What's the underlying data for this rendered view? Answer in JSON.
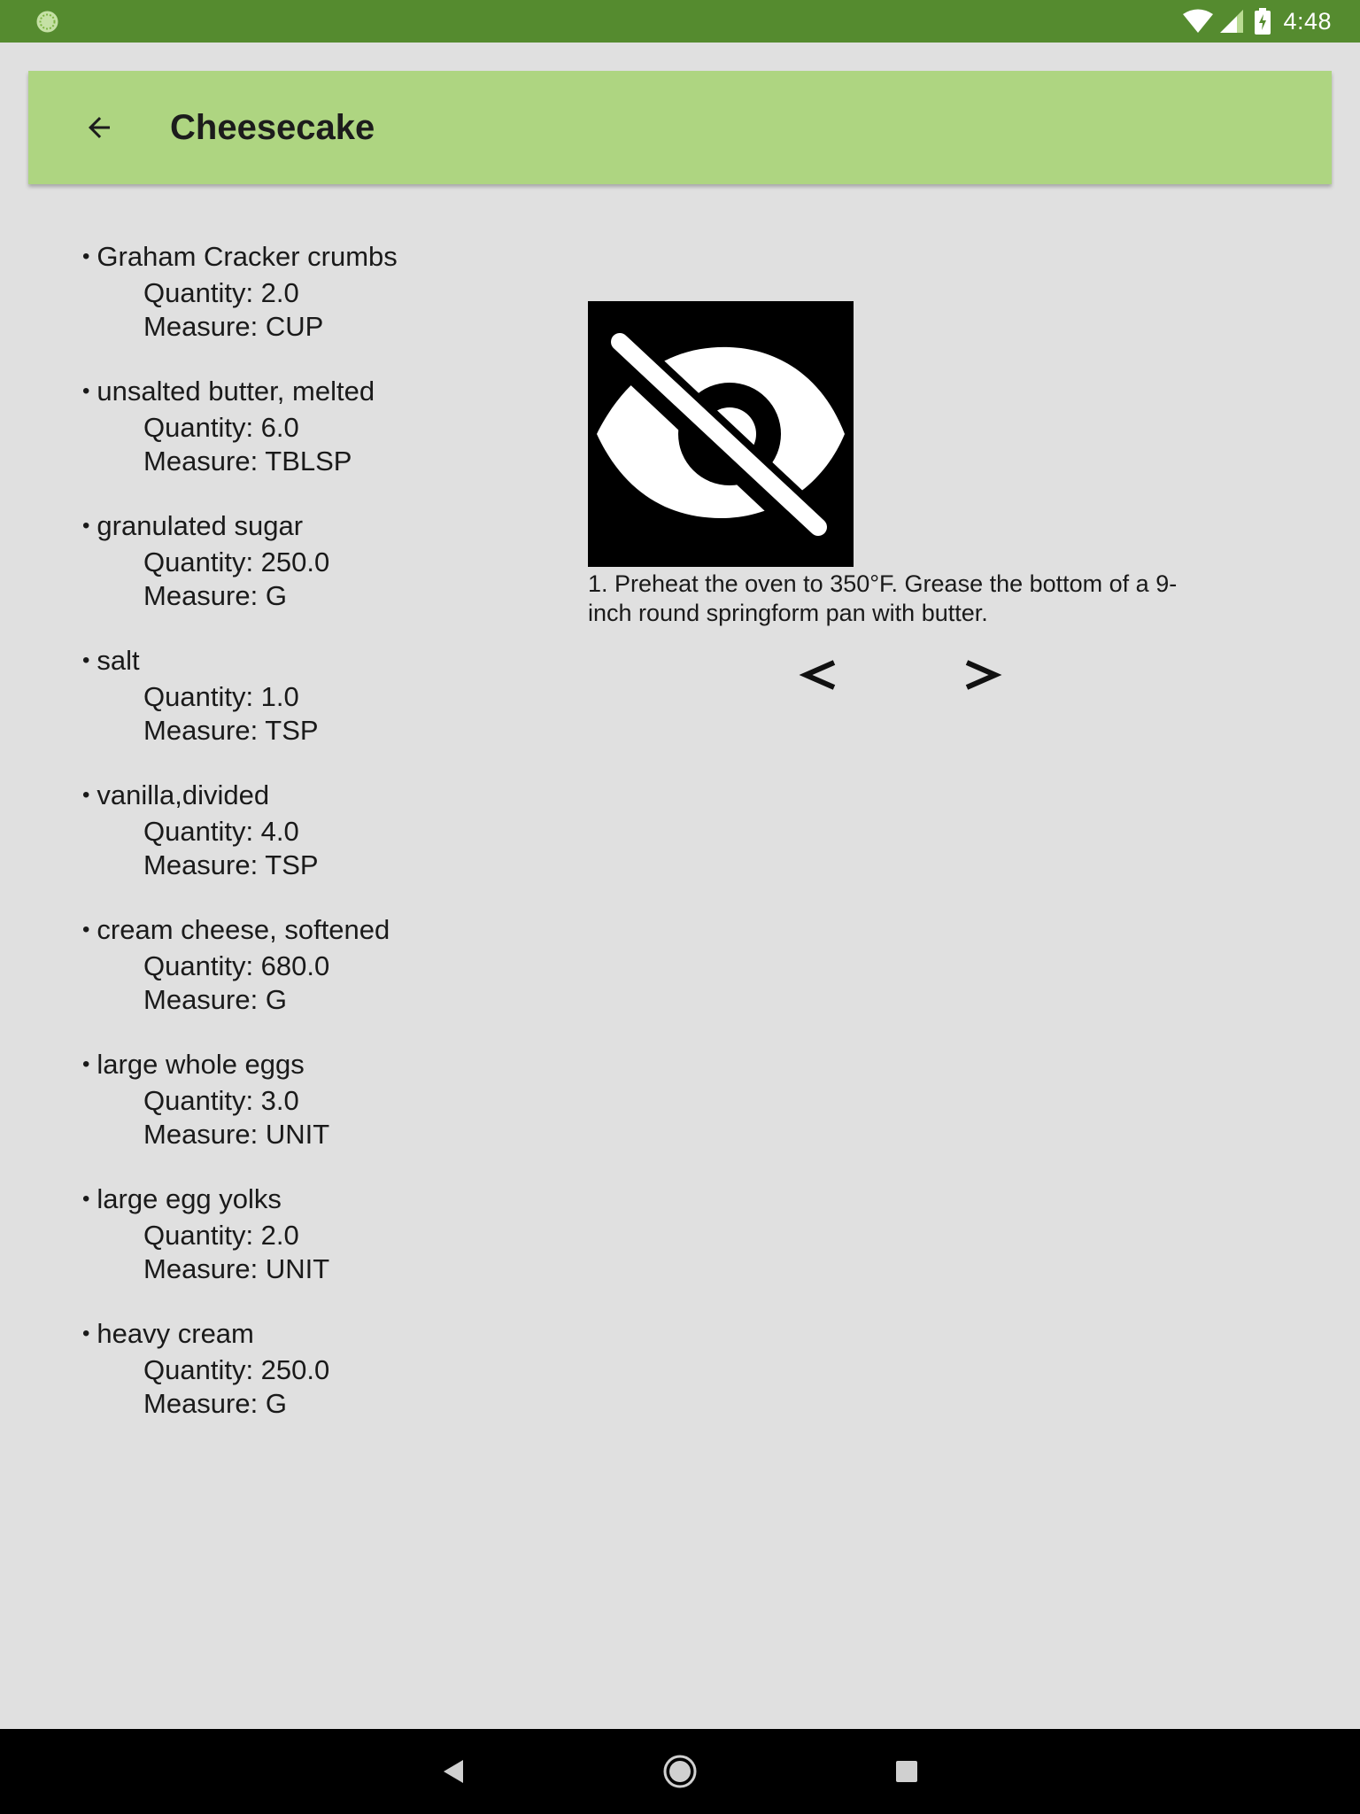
{
  "status_bar": {
    "time": "4:48"
  },
  "toolbar": {
    "title": "Cheesecake"
  },
  "ingredients": [
    {
      "name": "Graham Cracker crumbs",
      "quantity": "Quantity: 2.0",
      "measure": "Measure: CUP"
    },
    {
      "name": "unsalted butter, melted",
      "quantity": "Quantity: 6.0",
      "measure": "Measure: TBLSP"
    },
    {
      "name": "granulated sugar",
      "quantity": "Quantity: 250.0",
      "measure": "Measure: G"
    },
    {
      "name": "salt",
      "quantity": "Quantity: 1.0",
      "measure": "Measure: TSP"
    },
    {
      "name": "vanilla,divided",
      "quantity": "Quantity: 4.0",
      "measure": "Measure: TSP"
    },
    {
      "name": "cream cheese, softened",
      "quantity": "Quantity: 680.0",
      "measure": "Measure: G"
    },
    {
      "name": "large whole eggs",
      "quantity": "Quantity: 3.0",
      "measure": "Measure: UNIT"
    },
    {
      "name": "large egg yolks",
      "quantity": "Quantity: 2.0",
      "measure": "Measure: UNIT"
    },
    {
      "name": "heavy cream",
      "quantity": "Quantity: 250.0",
      "measure": "Measure: G"
    }
  ],
  "step": {
    "image_icon": "visibility-off-icon",
    "description": "1. Preheat the oven to 350°F. Grease the bottom of a 9-inch round springform pan with butter.",
    "prev_label": "<",
    "next_label": ">"
  },
  "colors": {
    "status_bar": "#558b2f",
    "toolbar": "#aed581",
    "background": "#e0e0e0",
    "nav_bar": "#000000"
  }
}
